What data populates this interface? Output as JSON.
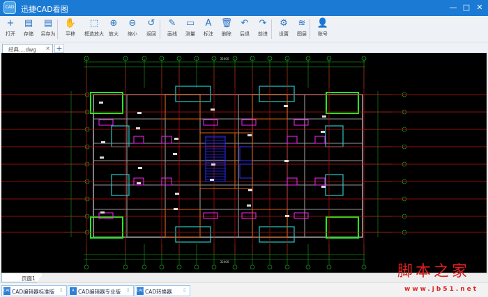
{
  "app": {
    "title": "迅捷CAD看图",
    "logo": "CAD"
  },
  "window_controls": {
    "minimize": "—",
    "maximize": "□",
    "close": "✕"
  },
  "toolbar": [
    {
      "label": "打开",
      "icon": "plus-icon",
      "glyph": "+"
    },
    {
      "label": "存储",
      "icon": "save-icon",
      "glyph": "▤"
    },
    {
      "label": "另存为",
      "icon": "save-as-icon",
      "glyph": "▤"
    },
    {
      "label": "平移",
      "icon": "hand-icon",
      "glyph": "✋"
    },
    {
      "label": "框选放大",
      "icon": "zoom-window-icon",
      "glyph": "⬚"
    },
    {
      "label": "放大",
      "icon": "zoom-in-icon",
      "glyph": "⊕"
    },
    {
      "label": "缩小",
      "icon": "zoom-out-icon",
      "glyph": "⊖"
    },
    {
      "label": "返回",
      "icon": "return-icon",
      "glyph": "↺"
    },
    {
      "label": "画线",
      "icon": "pencil-icon",
      "glyph": "✎"
    },
    {
      "label": "测量",
      "icon": "ruler-icon",
      "glyph": "▭"
    },
    {
      "label": "标注",
      "icon": "text-icon",
      "glyph": "A"
    },
    {
      "label": "删除",
      "icon": "trash-icon",
      "glyph": "🗑"
    },
    {
      "label": "后退",
      "icon": "undo-icon",
      "glyph": "↶"
    },
    {
      "label": "前进",
      "icon": "redo-icon",
      "glyph": "↷"
    },
    {
      "label": "设置",
      "icon": "gear-icon",
      "glyph": "⚙"
    },
    {
      "label": "图层",
      "icon": "layers-icon",
      "glyph": "≋"
    },
    {
      "label": "账号",
      "icon": "user-icon",
      "glyph": "👤"
    }
  ],
  "tabs": {
    "document": "经典....dwg",
    "close": "×",
    "add": "+"
  },
  "page_tab": "页面1",
  "bottom_buttons": [
    {
      "label": "CAD编辑器标准版",
      "icon": "CAD"
    },
    {
      "label": "CAD编辑器专业版",
      "icon": "A"
    },
    {
      "label": "CAD转换器",
      "icon": "CAD"
    }
  ],
  "drawing": {
    "top_total": "32400",
    "bottom_total": "32400"
  },
  "watermark": {
    "text": "脚本之家",
    "url": "www.jb51.net"
  }
}
